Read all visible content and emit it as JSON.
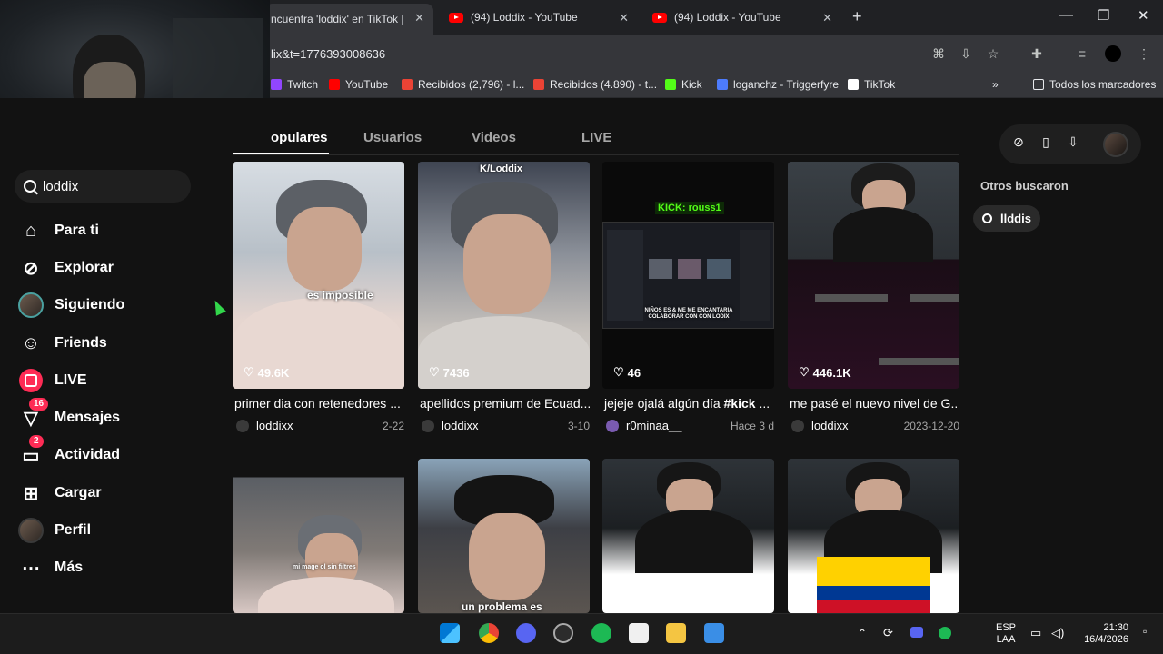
{
  "browser": {
    "tabs": [
      {
        "title": "ncuentra 'loddix' en TikTok | B",
        "active": true
      },
      {
        "title": "(94) Loddix - YouTube",
        "active": false
      },
      {
        "title": "(94) Loddix - YouTube",
        "active": false
      }
    ],
    "url": "lix&t=1776393008636",
    "bookmarks": [
      {
        "label": "Twitch",
        "icon": "twitch-icon",
        "color": "#9146ff"
      },
      {
        "label": "YouTube",
        "icon": "youtube-icon",
        "color": "#ff0000"
      },
      {
        "label": "Recibidos (2,796) - l...",
        "icon": "gmail-icon",
        "color": "#ea4335"
      },
      {
        "label": "Recibidos (4.890) - t...",
        "icon": "gmail-icon",
        "color": "#ea4335"
      },
      {
        "label": "Kick",
        "icon": "kick-icon",
        "color": "#53fc18"
      },
      {
        "label": "loganchz - Triggerfyre",
        "icon": "triggerfyre-icon",
        "color": "#4d7cfe"
      },
      {
        "label": "TikTok",
        "icon": "tiktok-icon",
        "color": "#ffffff"
      }
    ],
    "all_bookmarks": "Todos los marcadores"
  },
  "sidebar": {
    "search_value": "loddix",
    "items": [
      {
        "label": "Para ti",
        "icon": "home-icon"
      },
      {
        "label": "Explorar",
        "icon": "compass-icon"
      },
      {
        "label": "Siguiendo",
        "icon": "avatar-icon"
      },
      {
        "label": "Friends",
        "icon": "friends-icon"
      },
      {
        "label": "LIVE",
        "icon": "live-icon"
      },
      {
        "label": "Mensajes",
        "icon": "messages-icon",
        "badge": "16"
      },
      {
        "label": "Actividad",
        "icon": "activity-icon",
        "badge": "2"
      },
      {
        "label": "Cargar",
        "icon": "upload-icon"
      },
      {
        "label": "Perfil",
        "icon": "profile-avatar-icon"
      },
      {
        "label": "Más",
        "icon": "more-icon"
      }
    ]
  },
  "search_tabs": [
    "opulares",
    "Usuarios",
    "Videos",
    "LIVE"
  ],
  "videos": [
    {
      "likes": "49.6K",
      "caption": "primer dia con retenedores ...",
      "user": "loddixx",
      "date": "2-22",
      "overlay": "es imposible"
    },
    {
      "likes": "7436",
      "caption": "apellidos premium de Ecuad...",
      "user": "loddixx",
      "date": "3-10",
      "overlay": "K/Loddix"
    },
    {
      "likes": "46",
      "caption_prefix": "jejeje ojalá algún día ",
      "caption_tag": "#kick",
      "caption_suffix": " ...",
      "user": "r0minaa__",
      "date": "Hace 3 d",
      "overlay": "KICK: rouss1",
      "overlay2": "NIÑOS ES & ME ME ENCANTARIA COLABORAR CON CON LODIX"
    },
    {
      "likes": "446.1K",
      "caption": "me pasé el nuevo nivel de G...",
      "user": "loddixx",
      "date": "2023-12-20"
    },
    {
      "overlay": "mi mage ol sin filtres"
    },
    {
      "overlay": "un problema es"
    },
    {},
    {}
  ],
  "right_panel": {
    "others_title": "Otros buscaron",
    "others_chip": "llddis"
  },
  "taskbar": {
    "lang1": "ESP",
    "lang2": "LAA",
    "time": "21:30",
    "date": "16/4/2026"
  }
}
